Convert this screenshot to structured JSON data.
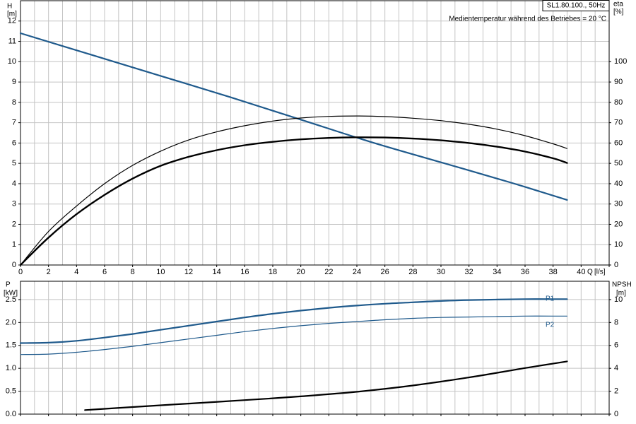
{
  "chart_data": [
    {
      "type": "line",
      "title_box": "SL1.80.100., 50Hz",
      "note": "Medientemperatur während des Betriebes = 20 °C",
      "left_axis": {
        "symbol": "H",
        "unit": "[m]",
        "ylim": [
          0,
          13
        ],
        "ticks": [
          0,
          1,
          2,
          3,
          4,
          5,
          6,
          7,
          8,
          9,
          10,
          11,
          12
        ]
      },
      "right_axis": {
        "symbol": "eta",
        "unit": "[%]",
        "ylim": [
          0,
          130
        ],
        "ticks": [
          0,
          10,
          20,
          30,
          40,
          50,
          60,
          70,
          80,
          90,
          100
        ]
      },
      "x_axis": {
        "symbol": "Q",
        "unit": "[l/s]",
        "xlim": [
          0,
          42
        ],
        "ticks": [
          0,
          2,
          4,
          6,
          8,
          10,
          12,
          14,
          16,
          18,
          20,
          22,
          24,
          26,
          28,
          30,
          32,
          34,
          36,
          38,
          40
        ]
      },
      "grid": true,
      "series": [
        {
          "axis": "left",
          "color": "#1f5a8c",
          "width": 2.2,
          "x": [
            0,
            5,
            10,
            15,
            20,
            25,
            30,
            35,
            39
          ],
          "y": [
            11.4,
            10.35,
            9.3,
            8.25,
            7.15,
            6.05,
            5.05,
            4.05,
            3.2
          ]
        },
        {
          "axis": "right",
          "color": "#000000",
          "width": 1.2,
          "x": [
            0,
            2,
            4,
            6,
            8,
            10,
            12,
            14,
            16,
            18,
            20,
            22,
            24,
            26,
            28,
            30,
            32,
            34,
            36,
            38,
            39
          ],
          "y": [
            0,
            16.5,
            29,
            40,
            49,
            56,
            61.5,
            65.5,
            68.5,
            70.8,
            72.3,
            73.1,
            73.3,
            73,
            72.2,
            71,
            69.2,
            66.8,
            63.6,
            59.6,
            57.3
          ]
        },
        {
          "axis": "right",
          "color": "#000000",
          "width": 2.4,
          "x": [
            0,
            2,
            4,
            6,
            8,
            10,
            12,
            14,
            16,
            18,
            20,
            22,
            24,
            26,
            28,
            30,
            32,
            34,
            36,
            38,
            39
          ],
          "y": [
            0,
            13.5,
            25,
            34.5,
            42.5,
            48.8,
            53.2,
            56.5,
            58.9,
            60.6,
            61.8,
            62.5,
            62.8,
            62.7,
            62.2,
            61.3,
            60,
            58.2,
            55.8,
            52.5,
            50.2
          ]
        }
      ]
    },
    {
      "type": "line",
      "left_axis": {
        "symbol": "P",
        "unit": "[kW]",
        "ylim": [
          0,
          2.9
        ],
        "ticks": [
          "0.0",
          "0.5",
          "1.0",
          "1.5",
          "2.0",
          "2.5"
        ]
      },
      "right_axis": {
        "symbol": "NPSH",
        "unit": "[m]",
        "ylim": [
          0,
          11.6
        ],
        "ticks": [
          0,
          2,
          4,
          6,
          8,
          10
        ]
      },
      "x_axis": {
        "xlim": [
          0,
          42
        ]
      },
      "grid": true,
      "series": [
        {
          "name": "P1",
          "axis": "left",
          "color": "#1f5a8c",
          "width": 2.2,
          "x": [
            0,
            2,
            4,
            6,
            8,
            10,
            12,
            14,
            16,
            18,
            20,
            22,
            24,
            26,
            28,
            30,
            32,
            34,
            36,
            38,
            39
          ],
          "y": [
            1.55,
            1.56,
            1.6,
            1.67,
            1.75,
            1.84,
            1.93,
            2.02,
            2.11,
            2.19,
            2.26,
            2.32,
            2.37,
            2.41,
            2.44,
            2.47,
            2.49,
            2.5,
            2.51,
            2.51,
            2.51
          ]
        },
        {
          "name": "P2",
          "axis": "left",
          "color": "#1f5a8c",
          "width": 1.2,
          "x": [
            0,
            2,
            4,
            6,
            8,
            10,
            12,
            14,
            16,
            18,
            20,
            22,
            24,
            26,
            28,
            30,
            32,
            34,
            36,
            38,
            39
          ],
          "y": [
            1.3,
            1.31,
            1.35,
            1.41,
            1.48,
            1.56,
            1.64,
            1.72,
            1.8,
            1.87,
            1.93,
            1.98,
            2.02,
            2.06,
            2.09,
            2.11,
            2.12,
            2.13,
            2.14,
            2.14,
            2.14
          ]
        },
        {
          "axis": "right",
          "color": "#000000",
          "width": 2.2,
          "x": [
            4.6,
            8,
            12,
            16,
            20,
            24,
            28,
            32,
            36,
            39
          ],
          "y": [
            0.35,
            0.62,
            0.92,
            1.22,
            1.55,
            1.95,
            2.5,
            3.2,
            4.02,
            4.6
          ]
        }
      ]
    }
  ]
}
